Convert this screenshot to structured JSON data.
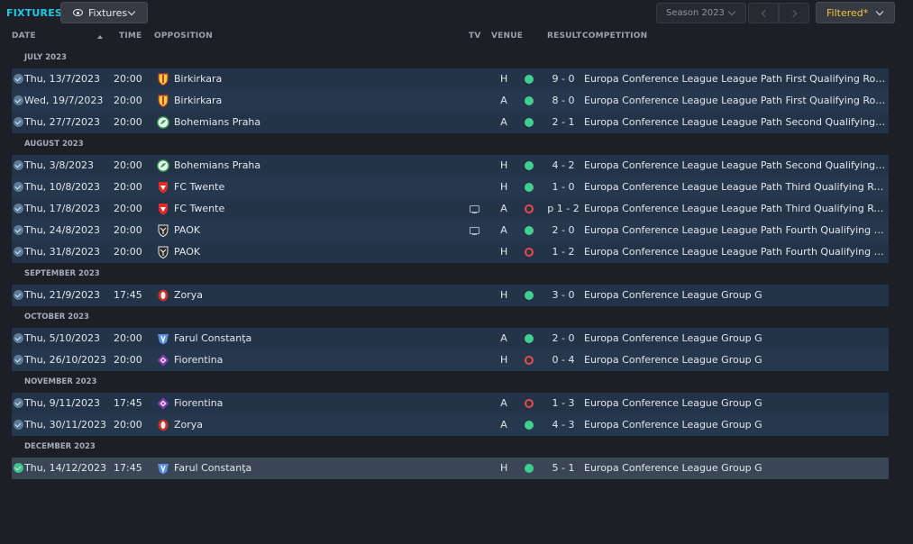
{
  "header": {
    "title": "FIXTURES",
    "view_label": "Fixtures",
    "season_label": "Season 2023",
    "filter_label": "Filtered*"
  },
  "columns": {
    "date": "DATE",
    "time": "TIME",
    "opposition": "OPPOSITION",
    "tv": "TV",
    "venue": "VENUE",
    "result": "RESULT",
    "competition": "COMPETITION"
  },
  "colors": {
    "accent": "#20c9e6",
    "win": "#3fcf8e",
    "loss": "#e84c4c",
    "filter": "#f5c33b"
  },
  "groups": [
    {
      "label": "JULY 2023",
      "fixtures": [
        {
          "date": "Thu, 13/7/2023",
          "time": "20:00",
          "team": "Birkirkara",
          "badge": "birkirkara-badge-icon",
          "tv": false,
          "venue": "H",
          "result": "win",
          "score": "9 - 0",
          "competition": "Europa Conference League League Path First Qualifying Round First Leg"
        },
        {
          "date": "Wed, 19/7/2023",
          "time": "20:00",
          "team": "Birkirkara",
          "badge": "birkirkara-badge-icon",
          "tv": false,
          "venue": "A",
          "result": "win",
          "score": "8 - 0",
          "competition": "Europa Conference League League Path First Qualifying Round Second Leg"
        },
        {
          "date": "Thu, 27/7/2023",
          "time": "20:00",
          "team": "Bohemians Praha",
          "badge": "bohemians-badge-icon",
          "tv": false,
          "venue": "A",
          "result": "win",
          "score": "2 - 1",
          "competition": "Europa Conference League League Path Second Qualifying Round First Leg"
        }
      ]
    },
    {
      "label": "AUGUST 2023",
      "fixtures": [
        {
          "date": "Thu, 3/8/2023",
          "time": "20:00",
          "team": "Bohemians Praha",
          "badge": "bohemians-badge-icon",
          "tv": false,
          "venue": "H",
          "result": "win",
          "score": "4 - 2",
          "competition": "Europa Conference League League Path Second Qualifying Round Second Leg"
        },
        {
          "date": "Thu, 10/8/2023",
          "time": "20:00",
          "team": "FC Twente",
          "badge": "twente-badge-icon",
          "tv": false,
          "venue": "H",
          "result": "win",
          "score": "1 - 0",
          "competition": "Europa Conference League League Path Third Qualifying Round First Leg"
        },
        {
          "date": "Thu, 17/8/2023",
          "time": "20:00",
          "team": "FC Twente",
          "badge": "twente-badge-icon",
          "tv": true,
          "venue": "A",
          "result": "loss",
          "score": "p 1 - 2",
          "competition": "Europa Conference League League Path Third Qualifying Round Second Leg"
        },
        {
          "date": "Thu, 24/8/2023",
          "time": "20:00",
          "team": "PAOK",
          "badge": "paok-badge-icon",
          "tv": true,
          "venue": "A",
          "result": "win",
          "score": "2 - 0",
          "competition": "Europa Conference League League Path Fourth Qualifying Round First Leg"
        },
        {
          "date": "Thu, 31/8/2023",
          "time": "20:00",
          "team": "PAOK",
          "badge": "paok-badge-icon",
          "tv": false,
          "venue": "H",
          "result": "loss",
          "score": "1 - 2",
          "competition": "Europa Conference League League Path Fourth Qualifying Round Second Leg"
        }
      ]
    },
    {
      "label": "SEPTEMBER 2023",
      "fixtures": [
        {
          "date": "Thu, 21/9/2023",
          "time": "17:45",
          "team": "Zorya",
          "badge": "zorya-badge-icon",
          "tv": false,
          "venue": "H",
          "result": "win",
          "score": "3 - 0",
          "competition": "Europa Conference League Group G"
        }
      ]
    },
    {
      "label": "OCTOBER 2023",
      "fixtures": [
        {
          "date": "Thu, 5/10/2023",
          "time": "20:00",
          "team": "Farul Constanţa",
          "badge": "farul-badge-icon",
          "tv": false,
          "venue": "A",
          "result": "win",
          "score": "2 - 0",
          "competition": "Europa Conference League Group G"
        },
        {
          "date": "Thu, 26/10/2023",
          "time": "20:00",
          "team": "Fiorentina",
          "badge": "fiorentina-badge-icon",
          "tv": false,
          "venue": "H",
          "result": "loss",
          "score": "0 - 4",
          "competition": "Europa Conference League Group G"
        }
      ]
    },
    {
      "label": "NOVEMBER 2023",
      "fixtures": [
        {
          "date": "Thu, 9/11/2023",
          "time": "17:45",
          "team": "Fiorentina",
          "badge": "fiorentina-badge-icon",
          "tv": false,
          "venue": "A",
          "result": "loss",
          "score": "1 - 3",
          "competition": "Europa Conference League Group G"
        },
        {
          "date": "Thu, 30/11/2023",
          "time": "20:00",
          "team": "Zorya",
          "badge": "zorya-badge-icon",
          "tv": false,
          "venue": "A",
          "result": "win",
          "score": "4 - 3",
          "competition": "Europa Conference League Group G"
        }
      ]
    },
    {
      "label": "DECEMBER 2023",
      "fixtures": [
        {
          "date": "Thu, 14/12/2023",
          "time": "17:45",
          "team": "Farul Constanţa",
          "badge": "farul-badge-icon",
          "tv": false,
          "venue": "H",
          "result": "win",
          "score": "5 - 1",
          "competition": "Europa Conference League Group G",
          "selected": true
        }
      ]
    }
  ]
}
